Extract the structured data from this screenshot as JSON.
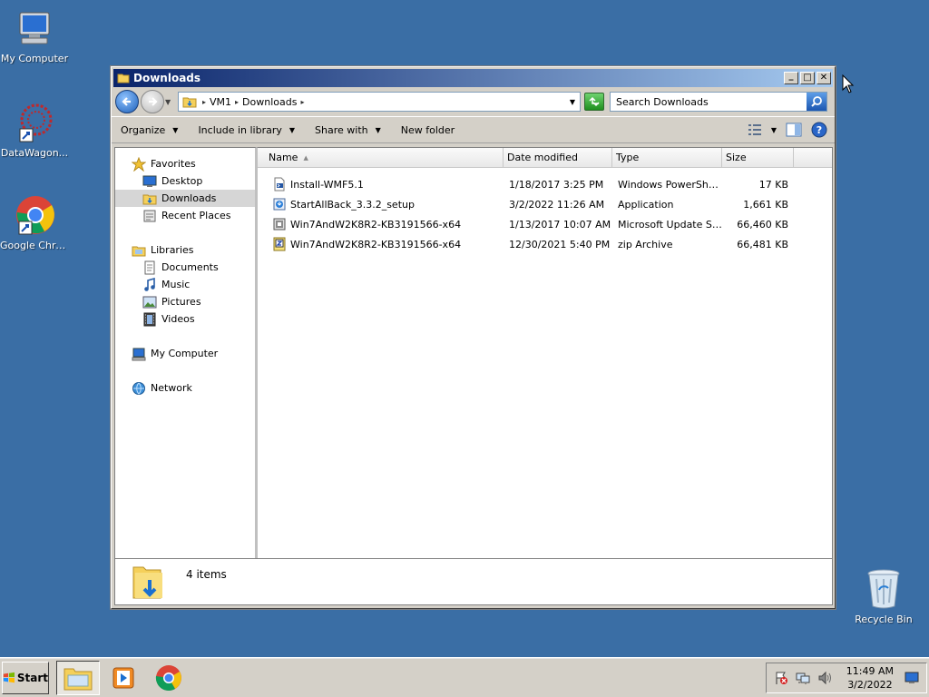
{
  "desktop": {
    "icons": [
      {
        "label": "My Computer"
      },
      {
        "label": "DataWagon..."
      },
      {
        "label": "Google Chrome"
      },
      {
        "label": "Recycle Bin"
      }
    ]
  },
  "window": {
    "title": "Downloads",
    "controls": {
      "minimize": "_",
      "maximize": "□",
      "close": "✕"
    },
    "address": {
      "crumbs": [
        "VM1",
        "Downloads"
      ]
    },
    "search": {
      "placeholder": "Search Downloads"
    },
    "toolbar": {
      "organize": "Organize",
      "include": "Include in library",
      "share": "Share with",
      "new_folder": "New folder"
    },
    "nav": {
      "favorites": "Favorites",
      "desktop": "Desktop",
      "downloads": "Downloads",
      "recent": "Recent Places",
      "libraries": "Libraries",
      "documents": "Documents",
      "music": "Music",
      "pictures": "Pictures",
      "videos": "Videos",
      "computer": "My Computer",
      "network": "Network"
    },
    "columns": {
      "name": "Name",
      "date": "Date modified",
      "type": "Type",
      "size": "Size"
    },
    "files": [
      {
        "name": "Install-WMF5.1",
        "date": "1/18/2017 3:25 PM",
        "type": "Windows PowerShel...",
        "size": "17 KB",
        "icon": "powershell-script-icon"
      },
      {
        "name": "StartAllBack_3.3.2_setup",
        "date": "3/2/2022 11:26 AM",
        "type": "Application",
        "size": "1,661 KB",
        "icon": "application-icon"
      },
      {
        "name": "Win7AndW2K8R2-KB3191566-x64",
        "date": "1/13/2017 10:07 AM",
        "type": "Microsoft Update St...",
        "size": "66,460 KB",
        "icon": "msu-package-icon"
      },
      {
        "name": "Win7AndW2K8R2-KB3191566-x64",
        "date": "12/30/2021 5:40 PM",
        "type": "zip Archive",
        "size": "66,481 KB",
        "icon": "zip-archive-icon"
      }
    ],
    "status": {
      "count": "4 items"
    }
  },
  "taskbar": {
    "start": "Start",
    "clock": {
      "time": "11:49 AM",
      "date": "3/2/2022"
    }
  }
}
